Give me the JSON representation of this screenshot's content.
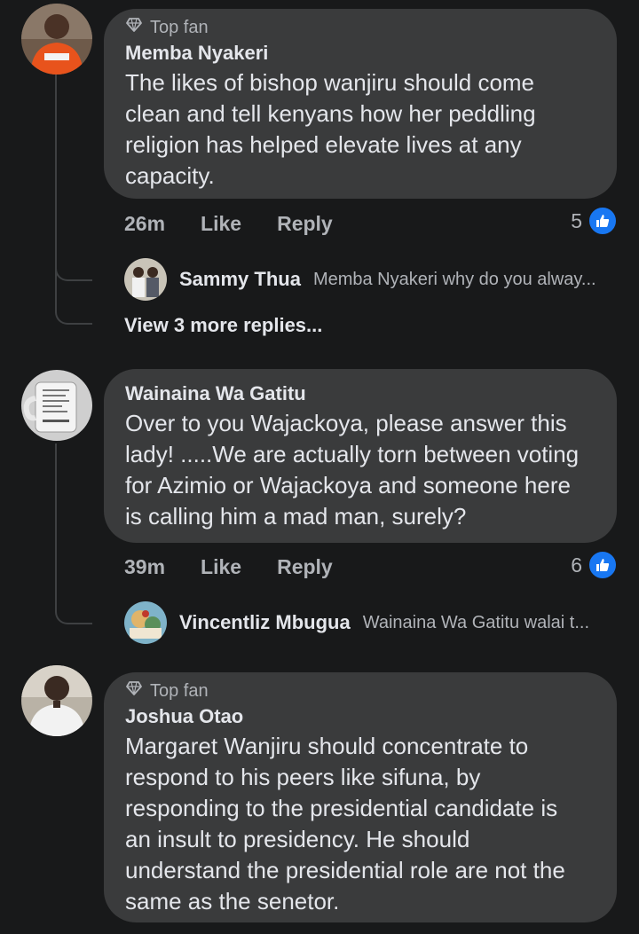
{
  "comments": [
    {
      "badge": "Top fan",
      "author": "Memba Nyakeri",
      "lines": [
        "The likes of bishop wanjiru should come",
        "clean and tell kenyans how her peddling",
        "religion has helped elevate lives at any",
        "capacity."
      ],
      "time": "26m",
      "like_label": "Like",
      "reply_label": "Reply",
      "reaction_count": "5",
      "reply": {
        "author": "Sammy Thua",
        "text": "Memba Nyakeri why do you alway..."
      },
      "view_more": "View 3 more replies..."
    },
    {
      "author": "Wainaina Wa Gatitu",
      "lines": [
        "Over to you Wajackoya, please answer this",
        "lady! .....We are actually torn between voting",
        "for Azimio or Wajackoya and someone here",
        "is calling him a mad man, surely?"
      ],
      "time": "39m",
      "like_label": "Like",
      "reply_label": "Reply",
      "reaction_count": "6",
      "reply": {
        "author": "Vincentliz Mbugua",
        "text": "Wainaina Wa Gatitu walai t..."
      }
    },
    {
      "badge": "Top fan",
      "author": "Joshua Otao",
      "lines": [
        "Margaret Wanjiru should concentrate to",
        "respond to his peers like sifuna, by",
        "responding to the presidential candidate is",
        "an insult to presidency. He should",
        "understand the presidential role are not the",
        "same as the senetor."
      ]
    }
  ],
  "colors": {
    "background": "#18191a",
    "bubble": "#3a3b3c",
    "text_primary": "#e4e6eb",
    "text_secondary": "#b0b3b8",
    "like_blue": "#1877f2"
  },
  "icons": {
    "badge": "diamond-icon",
    "reaction": "thumbs-up-icon"
  }
}
